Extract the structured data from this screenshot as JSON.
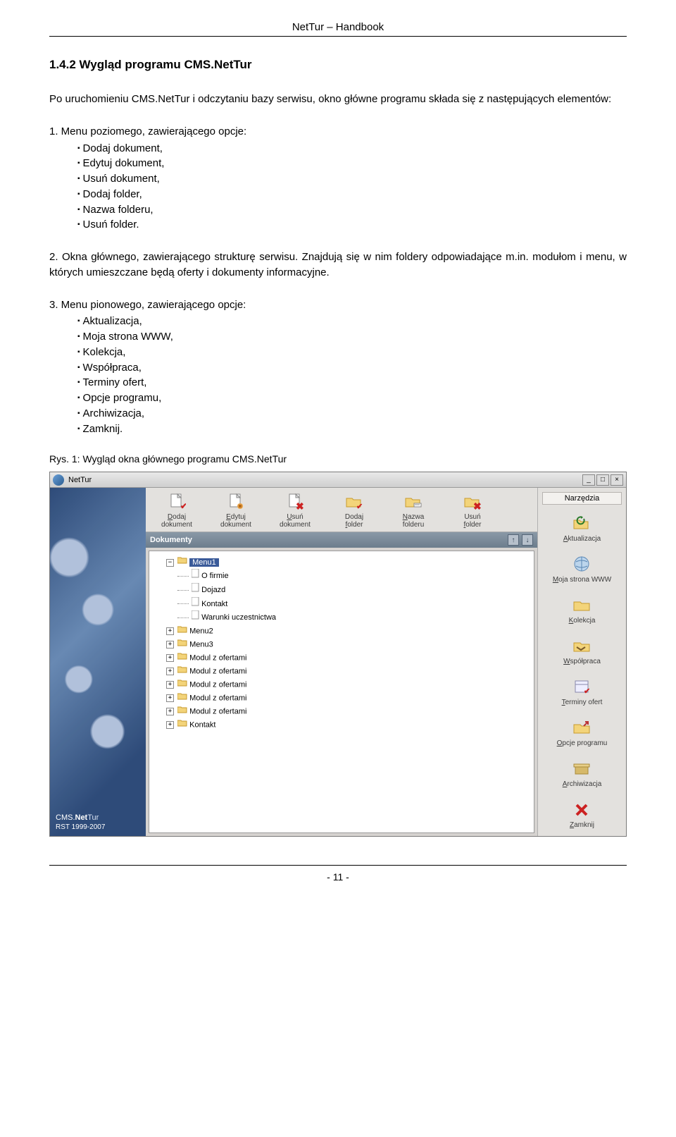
{
  "header": {
    "title": "NetTur – Handbook"
  },
  "section": {
    "heading": "1.4.2 Wygląd programu CMS.NetTur"
  },
  "para1": "Po uruchomieniu CMS.NetTur i odczytaniu bazy serwisu, okno główne programu składa się z następujących elementów:",
  "list1": {
    "intro": "1. Menu poziomego, zawierającego opcje:",
    "items": [
      "Dodaj dokument,",
      "Edytuj dokument,",
      "Usuń dokument,",
      "Dodaj folder,",
      "Nazwa folderu,",
      "Usuń folder."
    ]
  },
  "para2": "2. Okna głównego, zawierającego strukturę serwisu. Znajdują się w nim foldery odpowiadające m.in. modułom i menu, w których umieszczane będą oferty i dokumenty informacyjne.",
  "list3": {
    "intro": "3. Menu pionowego, zawierającego opcje:",
    "items": [
      "Aktualizacja,",
      "Moja strona WWW,",
      "Kolekcja,",
      "Współpraca,",
      "Terminy ofert,",
      "Opcje programu,",
      "Archiwizacja,",
      "Zamknij."
    ]
  },
  "figure_caption": "Rys. 1: Wygląd okna głównego programu CMS.NetTur",
  "app": {
    "title": "NetTur",
    "toolbar": [
      {
        "label1": "Dodaj",
        "label2": "dokument",
        "u": "D",
        "icon": "doc-add"
      },
      {
        "label1": "Edytuj",
        "label2": "dokument",
        "u": "E",
        "icon": "doc-edit"
      },
      {
        "label1": "Usuń",
        "label2": "dokument",
        "u": "U",
        "icon": "doc-del"
      },
      {
        "label1": "Dodaj",
        "label2": "folder",
        "u": "f",
        "icon": "fold-add"
      },
      {
        "label1": "Nazwa",
        "label2": "folderu",
        "u": "N",
        "icon": "fold-name"
      },
      {
        "label1": "Usuń",
        "label2": "folder",
        "u": "f",
        "icon": "fold-del"
      }
    ],
    "panel_title": "Dokumenty",
    "tree": {
      "root": "Menu1",
      "children": [
        "O firmie",
        "Dojazd",
        "Kontakt",
        "Warunki uczestnictwa"
      ],
      "siblings": [
        "Menu2",
        "Menu3",
        "Modul z ofertami",
        "Modul z ofertami",
        "Modul z ofertami",
        "Modul z ofertami",
        "Modul z ofertami",
        "Kontakt"
      ]
    },
    "tools_header": "Narzędzia",
    "side": [
      {
        "label": "Aktualizacja",
        "u": "A",
        "icon": "refresh"
      },
      {
        "label": "Moja strona WWW",
        "u": "M",
        "icon": "globe"
      },
      {
        "label": "Kolekcja",
        "u": "K",
        "icon": "folder"
      },
      {
        "label": "Współpraca",
        "u": "W",
        "icon": "handshake"
      },
      {
        "label": "Terminy ofert",
        "u": "T",
        "icon": "calendar"
      },
      {
        "label": "Opcje programu",
        "u": "O",
        "icon": "settings"
      },
      {
        "label": "Archiwizacja",
        "u": "A",
        "icon": "box"
      },
      {
        "label": "Zamknij",
        "u": "Z",
        "icon": "close"
      }
    ],
    "footer": {
      "line1": "CMS.NetTur",
      "line2": "RST 1999-2007"
    }
  },
  "pagenum": "- 11 -"
}
